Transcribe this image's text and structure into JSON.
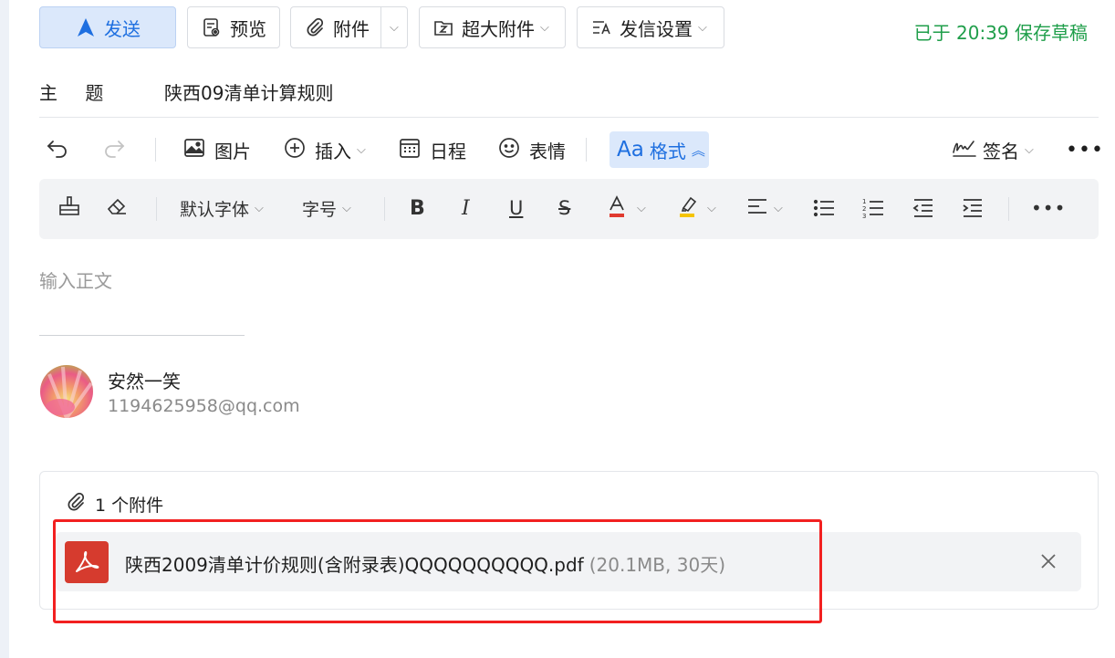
{
  "toolbar": {
    "send_label": "发送",
    "preview_label": "预览",
    "attach_label": "附件",
    "big_attach_label": "超大附件",
    "send_settings_label": "发信设置",
    "saved_status": "已于 20:39 保存草稿"
  },
  "subject": {
    "label": "主 题",
    "value": "陕西09清单计算规则"
  },
  "editor_toolbar": {
    "image_label": "图片",
    "insert_label": "插入",
    "schedule_label": "日程",
    "emoji_label": "表情",
    "format_label": "格式",
    "format_prefix": "Aa",
    "signature_label": "签名"
  },
  "format_toolbar": {
    "font_family": "默认字体",
    "font_size": "字号",
    "font_color": "#e03a2f",
    "highlight_color": "#f5c400"
  },
  "body": {
    "placeholder": "输入正文"
  },
  "signature": {
    "name": "安然一笑",
    "email": "1194625958@qq.com"
  },
  "attachments": {
    "count_label": "1 个附件",
    "files": [
      {
        "name": "陕西2009清单计价规则(含附录表)QQQQQQQQQQ.pdf",
        "meta": "(20.1MB, 30天)"
      }
    ]
  },
  "colors": {
    "accent": "#1e6fe0",
    "saved_green": "#1f9e4a",
    "pdf_red": "#d63b2e",
    "highlight_box": "#f22020"
  }
}
